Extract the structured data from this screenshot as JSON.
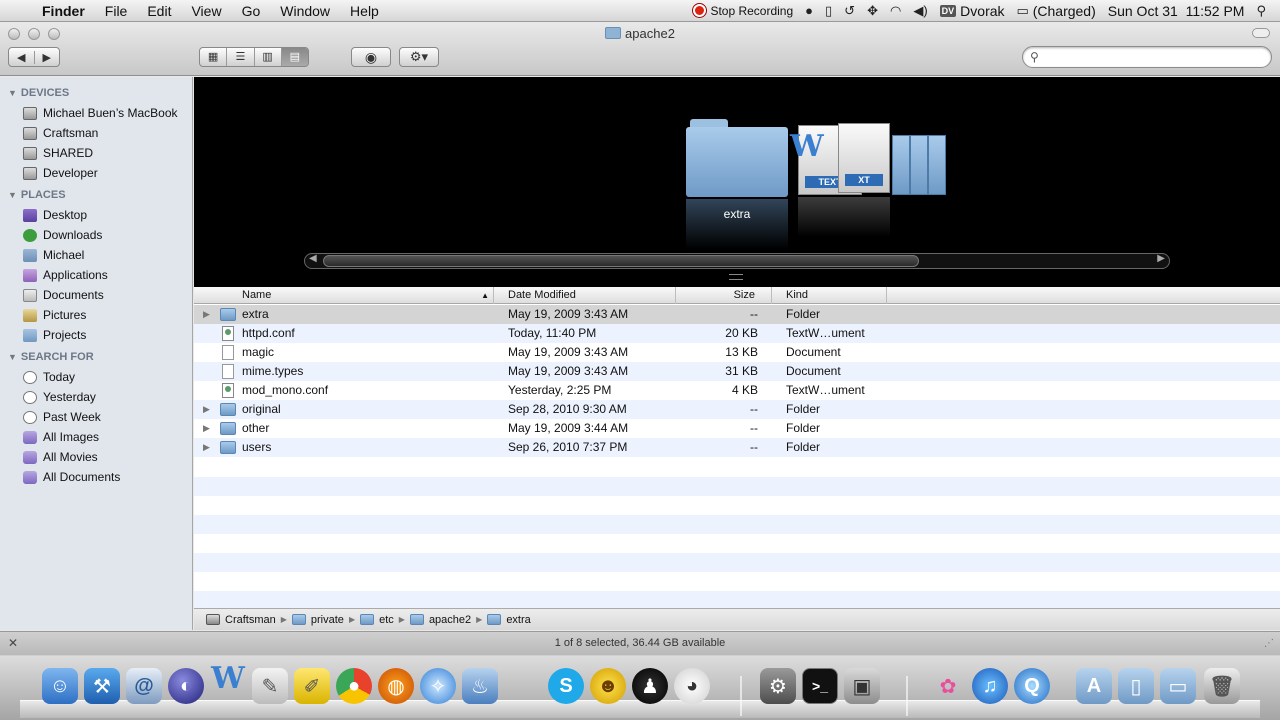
{
  "menubar": {
    "apple": "",
    "items": [
      "Finder",
      "File",
      "Edit",
      "View",
      "Go",
      "Window",
      "Help"
    ],
    "recording": "Stop Recording",
    "keyboard_abbrev": "DV",
    "keyboard": "Dvorak",
    "battery": "(Charged)",
    "date": "Sun Oct 31",
    "time": "11:52 PM"
  },
  "window": {
    "title": "apache2"
  },
  "sidebar": {
    "sections": [
      {
        "title": "DEVICES",
        "items": [
          {
            "label": "Michael Buen’s MacBook",
            "icon": "laptop-icon"
          },
          {
            "label": "Craftsman",
            "icon": "disk-icon"
          },
          {
            "label": "SHARED",
            "icon": "disk-icon"
          },
          {
            "label": "Developer",
            "icon": "disk-icon"
          }
        ]
      },
      {
        "title": "PLACES",
        "items": [
          {
            "label": "Desktop",
            "icon": "desktop-icon"
          },
          {
            "label": "Downloads",
            "icon": "downloads-icon"
          },
          {
            "label": "Michael",
            "icon": "home-icon"
          },
          {
            "label": "Applications",
            "icon": "applications-icon"
          },
          {
            "label": "Documents",
            "icon": "documents-icon"
          },
          {
            "label": "Pictures",
            "icon": "pictures-icon"
          },
          {
            "label": "Projects",
            "icon": "folder-icon"
          }
        ]
      },
      {
        "title": "SEARCH FOR",
        "items": [
          {
            "label": "Today",
            "icon": "clock-icon"
          },
          {
            "label": "Yesterday",
            "icon": "clock-icon"
          },
          {
            "label": "Past Week",
            "icon": "clock-icon"
          },
          {
            "label": "All Images",
            "icon": "smart-folder-icon"
          },
          {
            "label": "All Movies",
            "icon": "smart-folder-icon"
          },
          {
            "label": "All Documents",
            "icon": "smart-folder-icon"
          }
        ]
      }
    ]
  },
  "coverflow": {
    "caption": "extra",
    "doc_label_1": "TEXT",
    "doc_label_2": "XT"
  },
  "list": {
    "columns": {
      "name": "Name",
      "date": "Date Modified",
      "size": "Size",
      "kind": "Kind"
    },
    "rows": [
      {
        "name": "extra",
        "date": "May 19, 2009 3:43 AM",
        "size": "--",
        "kind": "Folder",
        "type": "folder",
        "selected": true
      },
      {
        "name": "httpd.conf",
        "date": "Today, 11:40 PM",
        "size": "20 KB",
        "kind": "TextW…ument",
        "type": "conf"
      },
      {
        "name": "magic",
        "date": "May 19, 2009 3:43 AM",
        "size": "13 KB",
        "kind": "Document",
        "type": "doc"
      },
      {
        "name": "mime.types",
        "date": "May 19, 2009 3:43 AM",
        "size": "31 KB",
        "kind": "Document",
        "type": "doc"
      },
      {
        "name": "mod_mono.conf",
        "date": "Yesterday, 2:25 PM",
        "size": "4 KB",
        "kind": "TextW…ument",
        "type": "conf"
      },
      {
        "name": "original",
        "date": "Sep 28, 2010 9:30 AM",
        "size": "--",
        "kind": "Folder",
        "type": "folder"
      },
      {
        "name": "other",
        "date": "May 19, 2009 3:44 AM",
        "size": "--",
        "kind": "Folder",
        "type": "folder"
      },
      {
        "name": "users",
        "date": "Sep 26, 2010 7:37 PM",
        "size": "--",
        "kind": "Folder",
        "type": "folder"
      }
    ]
  },
  "pathbar": [
    "Craftsman",
    "private",
    "etc",
    "apache2",
    "extra"
  ],
  "status": "1 of 8 selected, 36.44 GB available"
}
